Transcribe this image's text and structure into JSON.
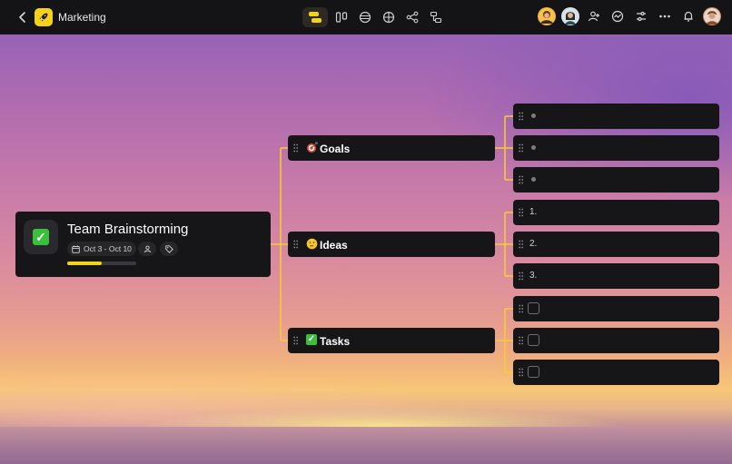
{
  "topbar": {
    "project_name": "Marketing",
    "view_tools": [
      {
        "icon": "mindmap-icon",
        "active": true
      },
      {
        "icon": "board-icon",
        "active": false
      },
      {
        "icon": "timeline-icon",
        "active": false
      },
      {
        "icon": "table-icon",
        "active": false
      },
      {
        "icon": "share-graph-icon",
        "active": false
      },
      {
        "icon": "org-chart-icon",
        "active": false
      }
    ],
    "right_tools": [
      "avatar-user-1",
      "avatar-user-2",
      "add-user-icon",
      "activity-icon",
      "settings-sliders-icon",
      "more-icon",
      "bell-icon",
      "avatar-current-user"
    ]
  },
  "root": {
    "title": "Team Brainstorming",
    "dates": "Oct 3 - Oct 10",
    "progress": 0.5,
    "accent": "#f2d317"
  },
  "branches": [
    {
      "label": "Goals",
      "emoji": "🎯"
    },
    {
      "label": "Ideas",
      "emoji": "🤔"
    },
    {
      "label": "Tasks",
      "emoji": "✓"
    }
  ],
  "leaves": {
    "goals": [
      "",
      "",
      ""
    ],
    "ideas": [
      "1.",
      "2.",
      "3."
    ],
    "tasks": [
      "",
      "",
      ""
    ]
  },
  "colors": {
    "connector": "#f6cf2c",
    "card": "#161618",
    "check": "#3cbf3c"
  }
}
